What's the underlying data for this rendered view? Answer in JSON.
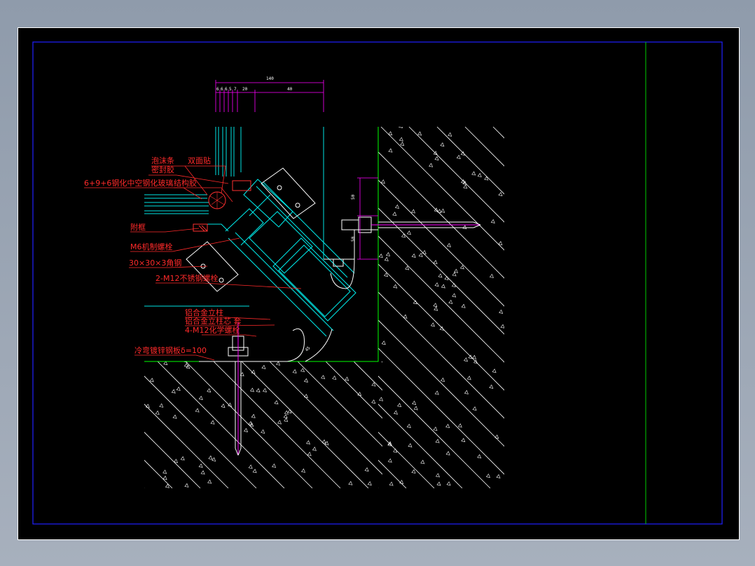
{
  "drawing": {
    "labels": {
      "foam_strip": "泡沫条",
      "double_tape": "双面贴",
      "sealant": "密封胶",
      "glass": "6+9+6钢化中空钢化玻璃",
      "structural_glue": "结构胶",
      "aux_frame": "附框",
      "bolt_m6": "M6机制螺栓",
      "angle_steel": "30×30×3角钢",
      "ss_bolt": "2-M12不锈钢螺栓",
      "alu_mullion": "铝合金立柱",
      "alu_mullion_core": "铝合金立柱芯 套",
      "chem_bolt": "4-M12化学螺栓",
      "steel_plate": "冷弯镀锌钢板δ=100"
    },
    "dimensions": {
      "total": "140",
      "seg1": "6",
      "seg2": "6",
      "seg3": "6",
      "seg4": "5",
      "seg5": "7",
      "seg6": "20",
      "seg7": "40",
      "bracket_a": "50",
      "bracket_b": "50",
      "angle_note": "45"
    },
    "colors": {
      "background": "#000000",
      "border": "#2020ff",
      "panel_line": "#00ff00",
      "profile": "#00e5e5",
      "annotation": "#ff2a2a",
      "dimension": "#ff00ff",
      "hatch": "#ffffff"
    }
  }
}
